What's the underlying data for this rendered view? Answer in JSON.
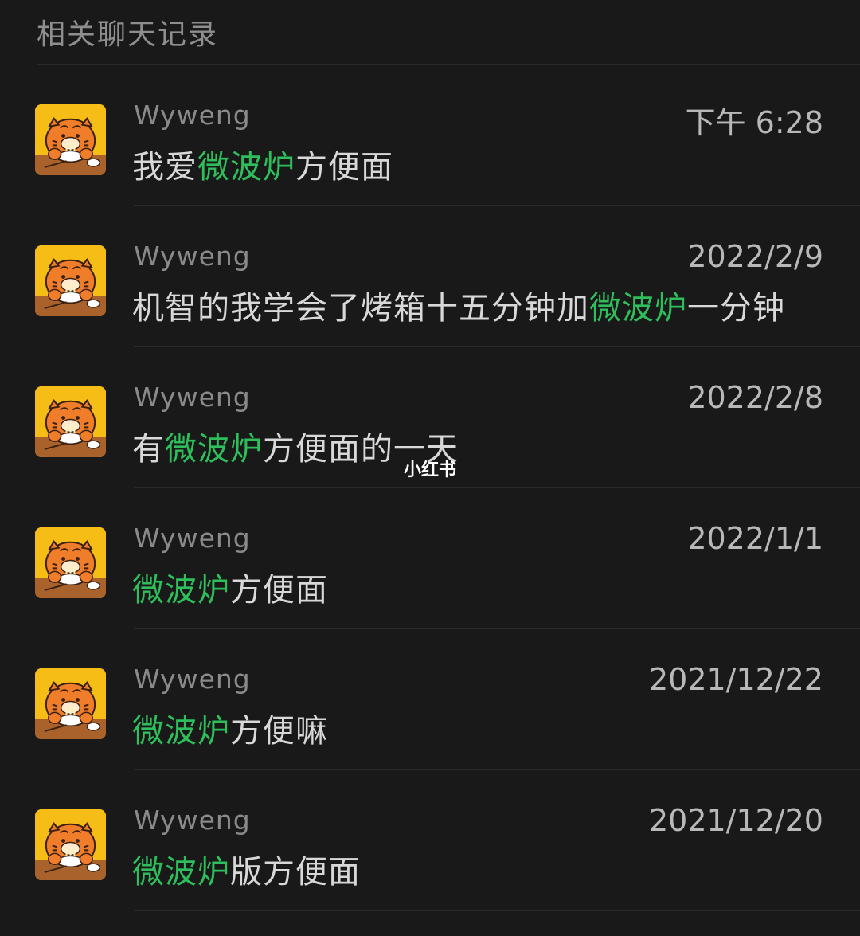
{
  "section_title": "相关聊天记录",
  "watermark": "小红书",
  "colors": {
    "background": "#191919",
    "highlight": "#2ebf5c",
    "avatar_bg": "#f6bd17"
  },
  "results": [
    {
      "sender": "Wyweng",
      "time": "下午 6:28",
      "avatar": "tiger-eating-noodles-icon",
      "message": {
        "before": "我爱",
        "highlight": "微波炉",
        "after": "方便面"
      }
    },
    {
      "sender": "Wyweng",
      "time": "2022/2/9",
      "avatar": "tiger-eating-noodles-icon",
      "message": {
        "before": "机智的我学会了烤箱十五分钟加",
        "highlight": "微波炉",
        "after": "一分钟"
      }
    },
    {
      "sender": "Wyweng",
      "time": "2022/2/8",
      "avatar": "tiger-eating-noodles-icon",
      "message": {
        "before": "有",
        "highlight": "微波炉",
        "after": "方便面的一天"
      }
    },
    {
      "sender": "Wyweng",
      "time": "2022/1/1",
      "avatar": "tiger-eating-noodles-icon",
      "message": {
        "before": "",
        "highlight": "微波炉",
        "after": "方便面"
      }
    },
    {
      "sender": "Wyweng",
      "time": "2021/12/22",
      "avatar": "tiger-eating-noodles-icon",
      "message": {
        "before": "",
        "highlight": "微波炉",
        "after": "方便嘛"
      }
    },
    {
      "sender": "Wyweng",
      "time": "2021/12/20",
      "avatar": "tiger-eating-noodles-icon",
      "message": {
        "before": "",
        "highlight": "微波炉",
        "after": "版方便面"
      }
    }
  ]
}
